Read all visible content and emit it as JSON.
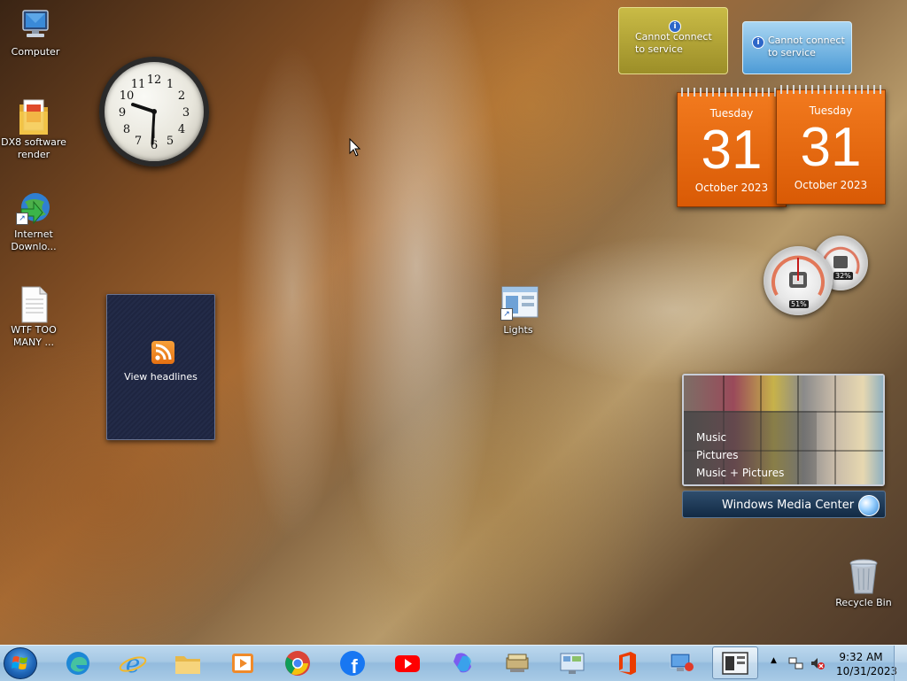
{
  "desktop_icons": [
    {
      "label": "Computer"
    },
    {
      "label": "DX8 software render"
    },
    {
      "label": "Internet Downlo..."
    },
    {
      "label": "WTF TOO MANY ..."
    },
    {
      "label": "Lights"
    },
    {
      "label": "Recycle Bin"
    }
  ],
  "clock": {
    "hour_numbers": [
      "12",
      "1",
      "2",
      "3",
      "4",
      "5",
      "6",
      "7",
      "8",
      "9",
      "10",
      "11"
    ]
  },
  "headlines": {
    "label": "View headlines"
  },
  "services": [
    {
      "text": "Cannot connect to service"
    },
    {
      "text": "Cannot connect to service"
    }
  ],
  "calendars": [
    {
      "weekday": "Tuesday",
      "day": "31",
      "month_year": "October 2023"
    },
    {
      "weekday": "Tuesday",
      "day": "31",
      "month_year": "October 2023"
    }
  ],
  "cpu_meter": {
    "cpu_percent": "51%",
    "memory_percent": "32%"
  },
  "media_center": {
    "menu": [
      "Music",
      "Pictures",
      "Music + Pictures"
    ],
    "brand": "Windows Media Center"
  },
  "taskbar": {
    "apps": [
      "Microsoft Edge",
      "Internet Explorer",
      "File Explorer",
      "Media Player",
      "Google Chrome",
      "Facebook",
      "YouTube",
      "Copilot",
      "Program Manager",
      "Control Panel",
      "Microsoft Office",
      "Remote Desktop",
      "Lights"
    ],
    "time": "9:32 AM",
    "date": "10/31/2023"
  }
}
